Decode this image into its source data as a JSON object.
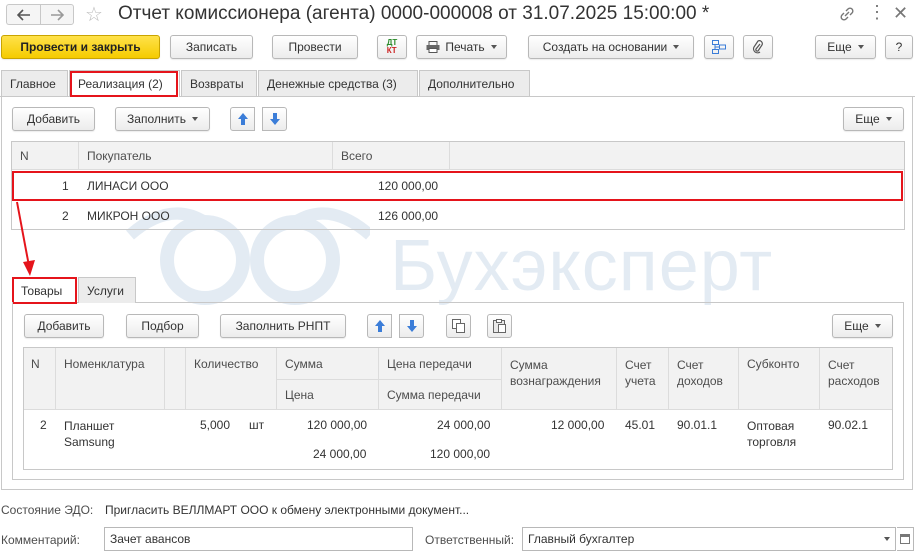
{
  "window": {
    "title": "Отчет комиссионера (агента) 0000-000008 от 31.07.2025 15:00:00 *"
  },
  "toolbar": {
    "post_close": "Провести и закрыть",
    "save": "Записать",
    "post": "Провести",
    "print": "Печать",
    "create_based": "Создать на основании",
    "more": "Еще",
    "help": "?"
  },
  "tabs": [
    {
      "label": "Главное"
    },
    {
      "label": "Реализация (2)"
    },
    {
      "label": "Возвраты"
    },
    {
      "label": "Денежные средства (3)"
    },
    {
      "label": "Дополнительно"
    }
  ],
  "sales_panel": {
    "add": "Добавить",
    "fill": "Заполнить",
    "more": "Еще",
    "columns": [
      "N",
      "Покупатель",
      "Всего"
    ],
    "rows": [
      {
        "n": "1",
        "buyer": "ЛИНАСИ ООО",
        "total": "120 000,00"
      },
      {
        "n": "2",
        "buyer": "МИКРОН ООО",
        "total": "126 000,00"
      }
    ]
  },
  "subtabs": [
    {
      "label": "Товары"
    },
    {
      "label": "Услуги"
    }
  ],
  "goods_panel": {
    "add": "Добавить",
    "pick": "Подбор",
    "fill_rnpt": "Заполнить РНПТ",
    "more": "Еще",
    "headers": {
      "n": "N",
      "item": "Номенклатура",
      "qty": "Количество",
      "sum": "Сумма",
      "price": "Цена",
      "transfer_price": "Цена передачи",
      "transfer_sum": "Сумма передачи",
      "fee_sum": "Сумма вознаграждения",
      "account": "Счет учета",
      "income_account": "Счет доходов",
      "subconto": "Субконто",
      "expense_account": "Счет расходов"
    },
    "row": {
      "n": "2",
      "item": "Планшет Samsung",
      "qty": "5,000",
      "unit": "шт",
      "sum": "120 000,00",
      "price": "24 000,00",
      "transfer_price": "24 000,00",
      "transfer_sum": "120 000,00",
      "fee_sum": "12 000,00",
      "account": "45.01",
      "income_account": "90.01.1",
      "subconto": "Оптовая торговля",
      "expense_account": "90.02.1"
    }
  },
  "footer": {
    "edo_label": "Состояние ЭДО:",
    "edo_link": "Пригласить ВЕЛЛМАРТ ООО к обмену электронными документ...",
    "comment_label": "Комментарий:",
    "comment_value": "Зачет авансов",
    "responsible_label": "Ответственный:",
    "responsible_value": "Главный бухгалтер"
  },
  "watermark": {
    "text": "Бухэксперт"
  },
  "colors": {
    "highlight": "#e5141b",
    "primary_button": "#f5cb00",
    "arrow_blue": "#3b7dd8"
  }
}
